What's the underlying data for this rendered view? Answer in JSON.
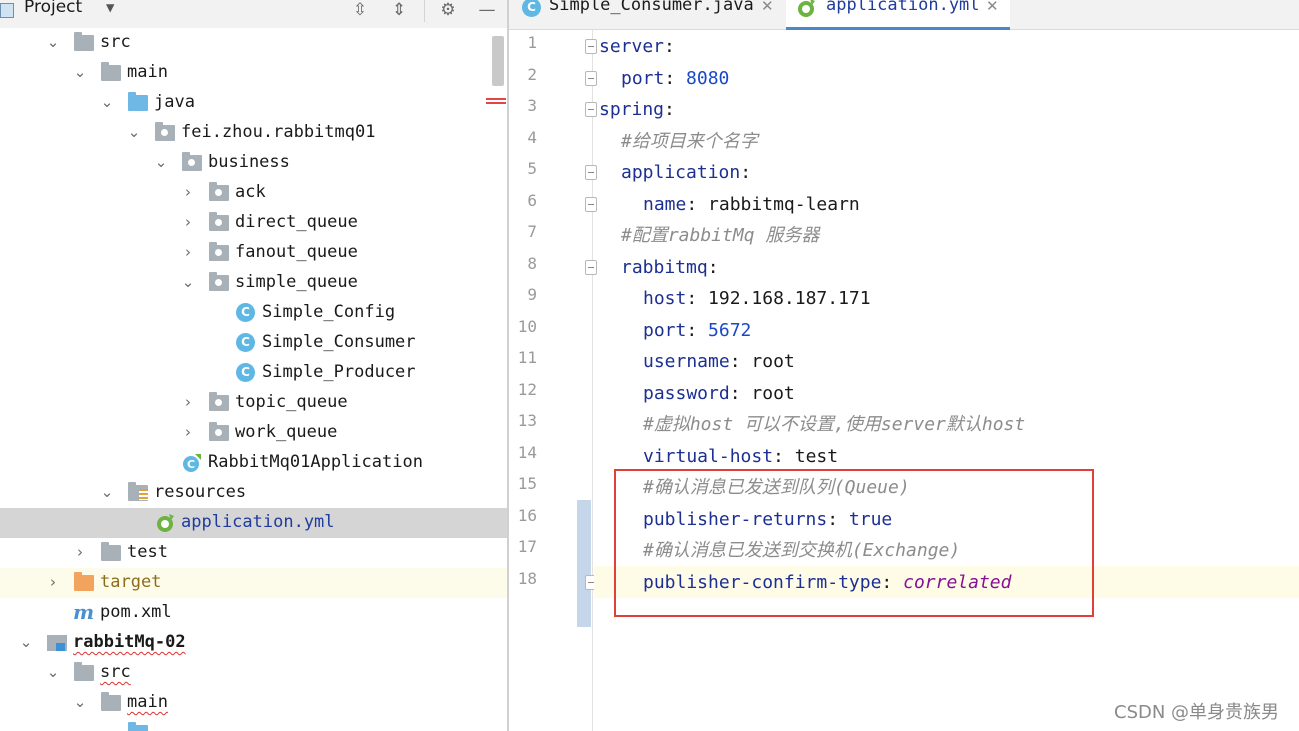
{
  "project_panel": {
    "title": "Project",
    "tree": [
      {
        "label": "src",
        "icon": "folder-icon",
        "expanded": true
      },
      {
        "label": "main",
        "icon": "folder-icon",
        "expanded": true
      },
      {
        "label": "java",
        "icon": "source-folder-icon",
        "expanded": true
      },
      {
        "label": "fei.zhou.rabbitmq01",
        "icon": "package-icon",
        "expanded": true
      },
      {
        "label": "business",
        "icon": "package-icon",
        "expanded": true
      },
      {
        "label": "ack",
        "icon": "package-icon",
        "expanded": false
      },
      {
        "label": "direct_queue",
        "icon": "package-icon",
        "expanded": false
      },
      {
        "label": "fanout_queue",
        "icon": "package-icon",
        "expanded": false
      },
      {
        "label": "simple_queue",
        "icon": "package-icon",
        "expanded": true
      },
      {
        "label": "Simple_Config",
        "icon": "class-icon"
      },
      {
        "label": "Simple_Consumer",
        "icon": "class-icon"
      },
      {
        "label": "Simple_Producer",
        "icon": "class-icon"
      },
      {
        "label": "topic_queue",
        "icon": "package-icon",
        "expanded": false
      },
      {
        "label": "work_queue",
        "icon": "package-icon",
        "expanded": false
      },
      {
        "label": "RabbitMq01Application",
        "icon": "spring-boot-class-icon"
      },
      {
        "label": "resources",
        "icon": "resources-folder-icon",
        "expanded": true
      },
      {
        "label": "application.yml",
        "icon": "spring-yaml-icon",
        "selected": true
      },
      {
        "label": "test",
        "icon": "folder-icon",
        "expanded": false
      },
      {
        "label": "target",
        "icon": "excluded-folder-icon",
        "expanded": false
      },
      {
        "label": "pom.xml",
        "icon": "maven-icon"
      },
      {
        "label": "rabbitMq-02",
        "icon": "module-icon",
        "expanded": true
      },
      {
        "label": "src",
        "icon": "folder-icon",
        "expanded": true
      },
      {
        "label": "main",
        "icon": "folder-icon",
        "expanded": true
      }
    ]
  },
  "editor": {
    "tabs": [
      {
        "label": "Simple_Consumer.java",
        "icon": "class-icon",
        "active": false
      },
      {
        "label": "application.yml",
        "icon": "spring-yaml-icon",
        "active": true
      }
    ],
    "line_numbers": [
      "1",
      "2",
      "3",
      "4",
      "5",
      "6",
      "7",
      "8",
      "9",
      "10",
      "11",
      "12",
      "13",
      "14",
      "15",
      "16",
      "17",
      "18"
    ],
    "lines": [
      {
        "key": "server",
        "colon": ":"
      },
      {
        "key": "port",
        "colon": ": ",
        "value": "8080"
      },
      {
        "key": "spring",
        "colon": ":"
      },
      {
        "comment": "#给项目来个名字"
      },
      {
        "key": "application",
        "colon": ":"
      },
      {
        "key": "name",
        "colon": ": ",
        "value": "rabbitmq-learn"
      },
      {
        "comment": "#配置rabbitMq 服务器"
      },
      {
        "key": "rabbitmq",
        "colon": ":"
      },
      {
        "key": "host",
        "colon": ": ",
        "value": "192.168.187.171"
      },
      {
        "key": "port",
        "colon": ": ",
        "value": "5672"
      },
      {
        "key": "username",
        "colon": ": ",
        "value": "root"
      },
      {
        "key": "password",
        "colon": ": ",
        "value": "root"
      },
      {
        "comment": "#虚拟host 可以不设置,使用server默认host"
      },
      {
        "key": "virtual-host",
        "colon": ": ",
        "value": "test"
      },
      {
        "comment": "#确认消息已发送到队列(Queue)"
      },
      {
        "key": "publisher-returns",
        "colon": ": ",
        "value": "true"
      },
      {
        "comment": "#确认消息已发送到交换机(Exchange)"
      },
      {
        "key": "publisher-confirm-type",
        "colon": ": ",
        "value": "correlated"
      }
    ]
  },
  "watermark": "CSDN @单身贵族男",
  "colors": {
    "highlight_box": "#e0403a",
    "key": "#1c2f93",
    "number": "#1a49c8",
    "comment": "#8c8c8c",
    "enum": "#871094"
  }
}
